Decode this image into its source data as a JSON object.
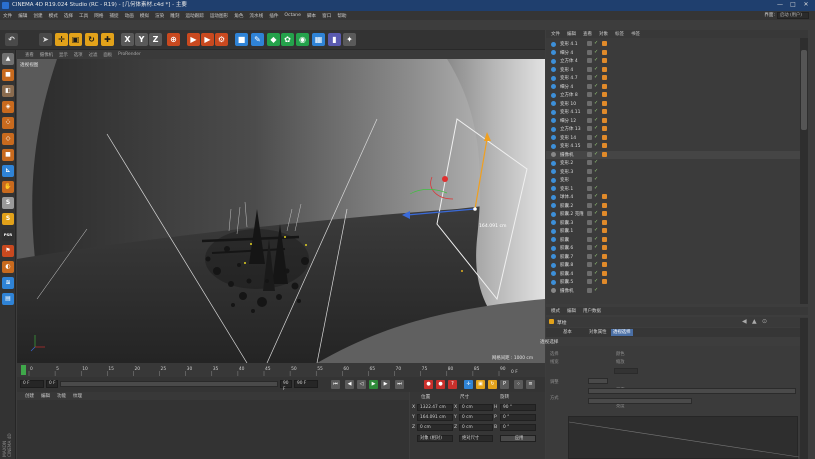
{
  "app": {
    "title": "CINEMA 4D R19.024 Studio (RC - R19) - [几何体素材.c4d *] - 主要",
    "window_controls": [
      "—",
      "□",
      "✕"
    ],
    "menu": [
      "文件",
      "编辑",
      "创建",
      "模式",
      "选择",
      "工具",
      "网格",
      "捕捉",
      "动画",
      "模拟",
      "渲染",
      "雕刻",
      "运动跟踪",
      "运动图形",
      "角色",
      "流水线",
      "插件",
      "Octane",
      "脚本",
      "窗口",
      "帮助"
    ],
    "layout_label": "界面:",
    "layout_value": "启动 (用户)"
  },
  "toolbar": {
    "buttons": [
      {
        "name": "undo-icon",
        "glyph": "↶",
        "color": "#4a4a4a",
        "fg": "#ddd"
      },
      {
        "name": "select-arrow-icon",
        "glyph": "➤",
        "color": "#4a4a4a",
        "fg": "#ddd"
      },
      {
        "name": "move-icon",
        "glyph": "✛",
        "color": "#e2a21a",
        "fg": "#1a1a1a"
      },
      {
        "name": "scale-icon",
        "glyph": "▣",
        "color": "#e2a21a",
        "fg": "#1a1a1a"
      },
      {
        "name": "rotate-icon",
        "glyph": "↻",
        "color": "#e2a21a",
        "fg": "#1a1a1a"
      },
      {
        "name": "last-tool-icon",
        "glyph": "✚",
        "color": "#e2a21a",
        "fg": "#1a1a1a"
      },
      {
        "name": "x-axis-icon",
        "glyph": "X",
        "color": "#5a5a5a",
        "fg": "#fff"
      },
      {
        "name": "y-axis-icon",
        "glyph": "Y",
        "color": "#5a5a5a",
        "fg": "#fff"
      },
      {
        "name": "z-axis-icon",
        "glyph": "Z",
        "color": "#5a5a5a",
        "fg": "#fff"
      },
      {
        "name": "coordinate-system-icon",
        "glyph": "⊕",
        "color": "#c9491f",
        "fg": "#fff"
      },
      {
        "name": "render-view-icon",
        "glyph": "▶",
        "color": "#c9491f",
        "fg": "#fff"
      },
      {
        "name": "render-picture-viewer-icon",
        "glyph": "▶",
        "color": "#c9491f",
        "fg": "#fff"
      },
      {
        "name": "render-settings-icon",
        "glyph": "⚙",
        "color": "#c9491f",
        "fg": "#fff"
      },
      {
        "name": "cube-icon",
        "glyph": "■",
        "color": "#2f83d6",
        "fg": "#fff"
      },
      {
        "name": "pen-icon",
        "glyph": "✎",
        "color": "#2f83d6",
        "fg": "#fff"
      },
      {
        "name": "subdivision-icon",
        "glyph": "◆",
        "color": "#24a24b",
        "fg": "#fff"
      },
      {
        "name": "array-icon",
        "glyph": "✿",
        "color": "#24a24b",
        "fg": "#fff"
      },
      {
        "name": "deformer-icon",
        "glyph": "◉",
        "color": "#24a24b",
        "fg": "#fff"
      },
      {
        "name": "floor-icon",
        "glyph": "▦",
        "color": "#2f83d6",
        "fg": "#fff"
      },
      {
        "name": "camera-icon",
        "glyph": "▮",
        "color": "#5a5ab0",
        "fg": "#fff"
      },
      {
        "name": "light-icon",
        "glyph": "✦",
        "color": "#5a5a5a",
        "fg": "#fff"
      }
    ]
  },
  "left_toolbar": {
    "items": [
      {
        "name": "make-editable-icon",
        "glyph": "▲",
        "color": "#707070"
      },
      {
        "name": "model-mode-icon",
        "glyph": "■",
        "color": "#c86a1e"
      },
      {
        "name": "texture-mode-icon",
        "glyph": "◧",
        "color": "#8a6b4e"
      },
      {
        "name": "workplane-icon",
        "glyph": "◈",
        "color": "#c86a1e"
      },
      {
        "name": "points-mode-icon",
        "glyph": "⁘",
        "color": "#c86a1e"
      },
      {
        "name": "edges-mode-icon",
        "glyph": "◇",
        "color": "#c86a1e"
      },
      {
        "name": "polygons-mode-icon",
        "glyph": "■",
        "color": "#c86a1e"
      },
      {
        "name": "enable-axis-icon",
        "glyph": "⊾",
        "color": "#2f83d6"
      },
      {
        "name": "tweak-mode-icon",
        "glyph": "✋",
        "color": "#c86a1e"
      },
      {
        "name": "snap-icon",
        "glyph": "S",
        "color": "#9a9a9a"
      },
      {
        "name": "solo-icon",
        "glyph": "S",
        "color": "#e2a21a"
      },
      {
        "name": "psr-icon",
        "glyph": "PSR",
        "color": "#303030"
      },
      {
        "name": "lock-icon",
        "glyph": "⚑",
        "color": "#c9491f"
      },
      {
        "name": "render-region-icon",
        "glyph": "◐",
        "color": "#c86a1e"
      },
      {
        "name": "layer-icon",
        "glyph": "≋",
        "color": "#2f83d6"
      },
      {
        "name": "grid-icon",
        "glyph": "▤",
        "color": "#2f83d6"
      }
    ],
    "brand_line1": "MAXON",
    "brand_line2": "CINEMA 4D"
  },
  "viewport": {
    "menu": [
      "查看",
      "摄像机",
      "显示",
      "选项",
      "过滤",
      "面板",
      "ProRender"
    ],
    "label": "透视视图",
    "grid_spacing": "网格间距 : 1000 cm",
    "measure": "164.091 cm"
  },
  "timeline": {
    "ticks": [
      "0",
      "5",
      "10",
      "15",
      "20",
      "25",
      "30",
      "35",
      "40",
      "45",
      "50",
      "55",
      "60",
      "65",
      "70",
      "75",
      "80",
      "85",
      "90"
    ],
    "current_frame": "0 F",
    "start": "0 F",
    "preview_start": "0 F",
    "preview_end": "90 F",
    "end": "90 F",
    "fps_field": "90 F"
  },
  "transport": {
    "buttons": [
      {
        "name": "go-to-start-icon",
        "glyph": "⏮",
        "color": "#5a5a5a"
      },
      {
        "name": "previous-key-icon",
        "glyph": "◀",
        "color": "#5a5a5a"
      },
      {
        "name": "play-back-icon",
        "glyph": "◁",
        "color": "#5a5a5a"
      },
      {
        "name": "play-forward-icon",
        "glyph": "▶",
        "color": "#2e8a3a"
      },
      {
        "name": "next-key-icon",
        "glyph": "▶",
        "color": "#5a5a5a"
      },
      {
        "name": "go-to-end-icon",
        "glyph": "⏭",
        "color": "#5a5a5a"
      },
      {
        "name": "record-keys-icon",
        "glyph": "●",
        "color": "#c9302c"
      },
      {
        "name": "autokey-icon",
        "glyph": "●",
        "color": "#c9302c"
      },
      {
        "name": "keyframe-selection-icon",
        "glyph": "?",
        "color": "#c9302c"
      },
      {
        "name": "position-key-icon",
        "glyph": "✛",
        "color": "#2f83d6"
      },
      {
        "name": "scale-key-icon",
        "glyph": "▣",
        "color": "#e2a21a"
      },
      {
        "name": "rotation-key-icon",
        "glyph": "↻",
        "color": "#e2a21a"
      },
      {
        "name": "parameter-key-icon",
        "glyph": "P",
        "color": "#5a5a5a"
      },
      {
        "name": "point-level-icon",
        "glyph": "⁘",
        "color": "#5a5a5a"
      },
      {
        "name": "scheme-icon",
        "glyph": "≡",
        "color": "#5a5a5a"
      }
    ]
  },
  "materials": {
    "menu": [
      "创建",
      "编辑",
      "功能",
      "纹理"
    ]
  },
  "coordinates": {
    "headers": [
      "位置",
      "尺寸",
      "旋转"
    ],
    "rows": [
      {
        "axis": "X",
        "pos": "1322.47 cm",
        "size": "0 cm",
        "rot_axis": "H",
        "rot": "90 °"
      },
      {
        "axis": "Y",
        "pos": "164.091 cm",
        "size": "0 cm",
        "rot_axis": "P",
        "rot": "0 °"
      },
      {
        "axis": "Z",
        "pos": "0 cm",
        "size": "0 cm",
        "rot_axis": "B",
        "rot": "0 °"
      }
    ],
    "mode": "对象 (相对)",
    "size_mode": "绝对尺寸",
    "apply": "应用"
  },
  "object_manager": {
    "menu": [
      "文件",
      "编辑",
      "查看",
      "对象",
      "标签",
      "书签"
    ],
    "rows": [
      {
        "name": "变形 4.1",
        "icon": "#3d8fd8",
        "tag": "#e08a2a"
      },
      {
        "name": "细分 4",
        "icon": "#3d8fd8",
        "tag": "#e08a2a"
      },
      {
        "name": "立方体 4",
        "icon": "#3d8fd8",
        "tag": "#e08a2a"
      },
      {
        "name": "变形 4",
        "icon": "#3d8fd8",
        "tag": "#e08a2a"
      },
      {
        "name": "变形 4.7",
        "icon": "#3d8fd8",
        "tag": "#e08a2a"
      },
      {
        "name": "细分 4",
        "icon": "#3d8fd8",
        "tag": "#e08a2a"
      },
      {
        "name": "立方体 8",
        "icon": "#3d8fd8",
        "tag": "#e08a2a"
      },
      {
        "name": "变形 10",
        "icon": "#3d8fd8",
        "tag": "#e08a2a"
      },
      {
        "name": "变形 4.11",
        "icon": "#3d8fd8",
        "tag": "#e08a2a"
      },
      {
        "name": "细分 12",
        "icon": "#3d8fd8",
        "tag": "#e08a2a"
      },
      {
        "name": "立方体 13",
        "icon": "#3d8fd8",
        "tag": "#e08a2a"
      },
      {
        "name": "变形 14",
        "icon": "#3d8fd8",
        "tag": "#e08a2a"
      },
      {
        "name": "变形 4.15",
        "icon": "#3d8fd8",
        "tag": "#e08a2a"
      },
      {
        "name": "摄像机",
        "icon": "#888888",
        "tag": "#e08a2a"
      },
      {
        "name": "变形.2",
        "icon": "#3d8fd8",
        "tag": ""
      },
      {
        "name": "变形.3",
        "icon": "#3d8fd8",
        "tag": ""
      },
      {
        "name": "变形",
        "icon": "#3d8fd8",
        "tag": ""
      },
      {
        "name": "变形.1",
        "icon": "#3d8fd8",
        "tag": ""
      },
      {
        "name": "球体.4",
        "icon": "#3d8fd8",
        "tag": "#e08a2a"
      },
      {
        "name": "胶囊.2",
        "icon": "#3d8fd8",
        "tag": "#e08a2a"
      },
      {
        "name": "胶囊.2 克隆",
        "icon": "#3d8fd8",
        "tag": "#e08a2a"
      },
      {
        "name": "胶囊.3",
        "icon": "#3d8fd8",
        "tag": "#e08a2a"
      },
      {
        "name": "胶囊.1",
        "icon": "#3d8fd8",
        "tag": "#e08a2a"
      },
      {
        "name": "胶囊",
        "icon": "#3d8fd8",
        "tag": "#e08a2a"
      },
      {
        "name": "胶囊.6",
        "icon": "#3d8fd8",
        "tag": "#e08a2a"
      },
      {
        "name": "胶囊.7",
        "icon": "#3d8fd8",
        "tag": "#e08a2a"
      },
      {
        "name": "胶囊.8",
        "icon": "#3d8fd8",
        "tag": "#e08a2a"
      },
      {
        "name": "胶囊.4",
        "icon": "#3d8fd8",
        "tag": "#e08a2a"
      },
      {
        "name": "胶囊.5",
        "icon": "#3d8fd8",
        "tag": "#e08a2a"
      },
      {
        "name": "摄像机",
        "icon": "#888888",
        "tag": ""
      }
    ]
  },
  "attributes": {
    "menu": [
      "模式",
      "编辑",
      "用户数据"
    ],
    "object_title": "草绘",
    "tabs": [
      "基本",
      "对象属性",
      "透视选择"
    ],
    "section": "透视选择",
    "labels": [
      "选择",
      "颜色",
      "线宽",
      "缩放",
      "调整",
      "强度",
      "方式",
      "亮度"
    ],
    "values": [
      "",
      "",
      "",
      "",
      "",
      "",
      "正常",
      ""
    ]
  },
  "colors": {
    "accent_orange": "#e2a21a",
    "selection_blue": "#2f83d6",
    "active_tab": "#4a6fa5"
  }
}
